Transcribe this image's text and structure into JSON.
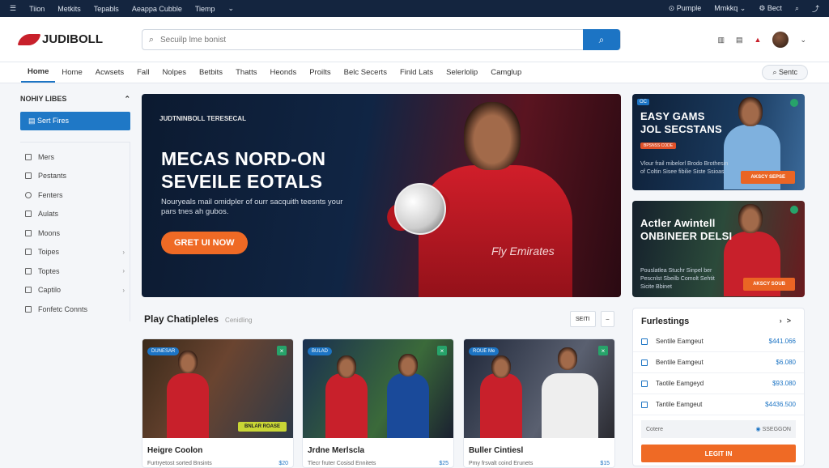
{
  "topbar": {
    "menu_icon": "hamburger-icon",
    "links": [
      "Tiion",
      "Metkits",
      "Tepabls",
      "Aeappa Cubble",
      "Tiemp"
    ],
    "right": [
      "Pumple",
      "Mmkkq",
      "Bect"
    ]
  },
  "header": {
    "logo_text": "JUDIBOLL",
    "search_placeholder": "Secuilp lme bonist",
    "icons": [
      "library-icon",
      "cart-icon",
      "bell-icon"
    ]
  },
  "nav": {
    "items": [
      "Home",
      "Home",
      "Acwsets",
      "Fall",
      "Nolpes",
      "Betbits",
      "Thatts",
      "Heonds",
      "Proilts",
      "Belc Secerts",
      "Finld Lats",
      "Selerlolip",
      "Camglup"
    ],
    "search_label": "Sentc"
  },
  "sidebar": {
    "header": "NOHIY LIBES",
    "primary": "Sert Fires",
    "items": [
      {
        "label": "Mers",
        "chevron": ""
      },
      {
        "label": "Pestants",
        "chevron": ""
      },
      {
        "label": "Fenters",
        "chevron": ""
      },
      {
        "label": "Aulats",
        "chevron": ""
      },
      {
        "label": "Moons",
        "chevron": ""
      },
      {
        "label": "Toipes",
        "chevron": "›"
      },
      {
        "label": "Toptes",
        "chevron": "›"
      },
      {
        "label": "Captilo",
        "chevron": "›"
      },
      {
        "label": "Fonfetc Connts",
        "chevron": ""
      }
    ]
  },
  "hero": {
    "brand": "JUDTNINBOLL TERESECAL",
    "headline_1": "MECAS NORD-ON",
    "headline_2": "SEVEILE EOTALS",
    "subtext": "Nouryeals mail omidpler of ourr sacquith teesnts your pars tnes ah gubos.",
    "cta": "GRET UI NOW",
    "jersey_text": "Fly Emirates"
  },
  "promos": [
    {
      "tag": "OC",
      "title_1": "EASY GAMS",
      "title_2": "JOL SECSTANS",
      "badge": "BPSNSS CODE",
      "desc": "Vlour frail mibelorl Brodo Brothesin of Coltin Sisee fibilie Siste Ssioas",
      "button": "AKSCY SEPSE"
    },
    {
      "tag": "",
      "title_1": "Actler Awintell",
      "title_2": "ONBINEER DELSI",
      "badge": "",
      "desc": "Pouslatlea Stuchr Sinpel ber Pescnlst Sbeilb Comolt Sehtit Sicite Bbinet",
      "button": "AKSCY SOUB"
    }
  ],
  "play": {
    "title": "Play Chatipleles",
    "subtitle": "Cenidling",
    "controls": [
      "SEITI",
      "–"
    ]
  },
  "cards": [
    {
      "label": "DUNESAR",
      "pill": "BNLAR ROASE",
      "name": "Heigre Coolon",
      "desc": "Furtryetost sorted Bnsints",
      "price": "$20"
    },
    {
      "label": "BULAD",
      "pill": "",
      "name": "Jrdne Merlscla",
      "desc": "Tlecr fruter Cosisd Ennitets",
      "price": "$25"
    },
    {
      "label": "ROUE Me",
      "pill": "",
      "name": "Buller Cintiesl",
      "desc": "Pmy frsvalt coind Erunets",
      "price": "$15"
    }
  ],
  "listings": {
    "title": "Furlestings",
    "rows": [
      {
        "label": "Sentile Eamgeut",
        "value": "$441.066"
      },
      {
        "label": "Bentile Eamgeut",
        "value": "$6.080"
      },
      {
        "label": "Taotile Eamgeyd",
        "value": "$93.080"
      },
      {
        "label": "Tantile Eamgeut",
        "value": "$4436.500"
      }
    ],
    "footer_left": "Cotere",
    "footer_right": "SSEGGON",
    "login": "LEGIT IN"
  }
}
